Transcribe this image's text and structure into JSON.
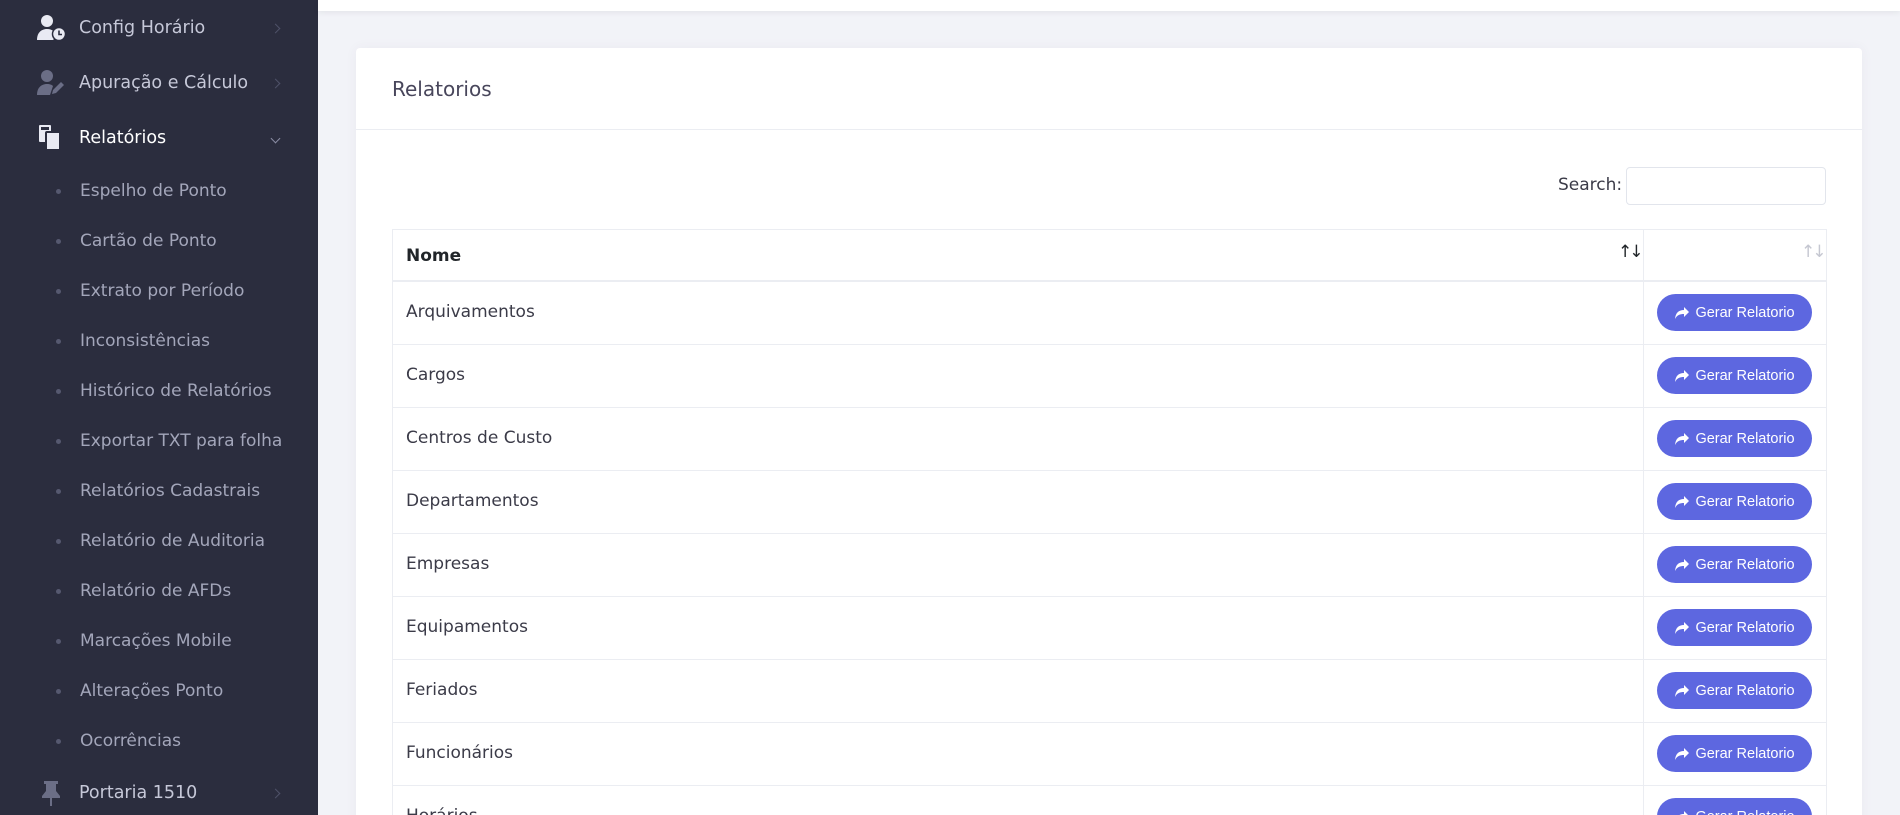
{
  "sidebar": {
    "menu": [
      {
        "label": "Config Horário",
        "icon": "user-clock-icon"
      },
      {
        "label": "Apuração e Cálculo",
        "icon": "user-edit-icon"
      },
      {
        "label": "Relatórios",
        "icon": "copy-documents-icon"
      },
      {
        "label": "Portaria 1510",
        "icon": "thumbtack-icon"
      }
    ],
    "submenu": [
      "Espelho de Ponto",
      "Cartão de Ponto",
      "Extrato por Período",
      "Inconsistências",
      "Histórico de Relatórios",
      "Exportar TXT para folha",
      "Relatórios Cadastrais",
      "Relatório de Auditoria",
      "Relatório de AFDs",
      "Marcações Mobile",
      "Alterações Ponto",
      "Ocorrências"
    ]
  },
  "card": {
    "title": "Relatorios",
    "search_label": "Search:",
    "search_value": ""
  },
  "table": {
    "columns": [
      "Nome",
      ""
    ],
    "sort_icon": "sort-icon",
    "button_label": "Gerar Relatorio",
    "button_icon": "share-arrow-icon",
    "rows": [
      "Arquivamentos",
      "Cargos",
      "Centros de Custo",
      "Departamentos",
      "Empresas",
      "Equipamentos",
      "Feriados",
      "Funcionários",
      "Horários"
    ]
  },
  "colors": {
    "sidebar_bg": "#2b2d3e",
    "page_bg": "#f2f3f8",
    "accent": "#5d67e0"
  }
}
